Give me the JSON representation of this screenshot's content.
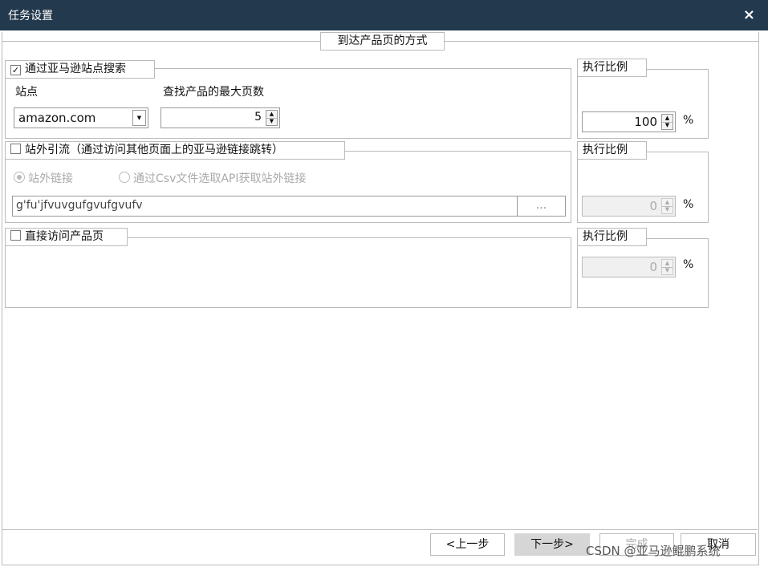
{
  "window": {
    "title": "任务设置",
    "close_glyph": "×"
  },
  "header": {
    "tab_label": "到达产品页的方式"
  },
  "section_search": {
    "checkbox_label": "通过亚马逊站点搜索",
    "checked": true,
    "site_label": "站点",
    "site_value": "amazon.com",
    "maxpages_label": "查找产品的最大页数",
    "maxpages_value": "5"
  },
  "ratio_search": {
    "legend": "执行比例",
    "value": "100",
    "unit": "%"
  },
  "section_external": {
    "checkbox_label": "站外引流（通过访问其他页面上的亚马逊链接跳转）",
    "checked": false,
    "radio_links": "站外链接",
    "radio_csv": "通过Csv文件选取API获取站外链接",
    "link_value": "g'fu'jfvuvgufgvufgvufv",
    "browse_label": "..."
  },
  "ratio_external": {
    "legend": "执行比例",
    "value": "0",
    "unit": "%"
  },
  "section_direct": {
    "checkbox_label": "直接访问产品页",
    "checked": false
  },
  "ratio_direct": {
    "legend": "执行比例",
    "value": "0",
    "unit": "%"
  },
  "footer": {
    "prev": "<上一步",
    "next": "下一步>",
    "finish": "完成",
    "cancel": "取消"
  },
  "watermark": "CSDN @亚马逊鲲鹏系统"
}
